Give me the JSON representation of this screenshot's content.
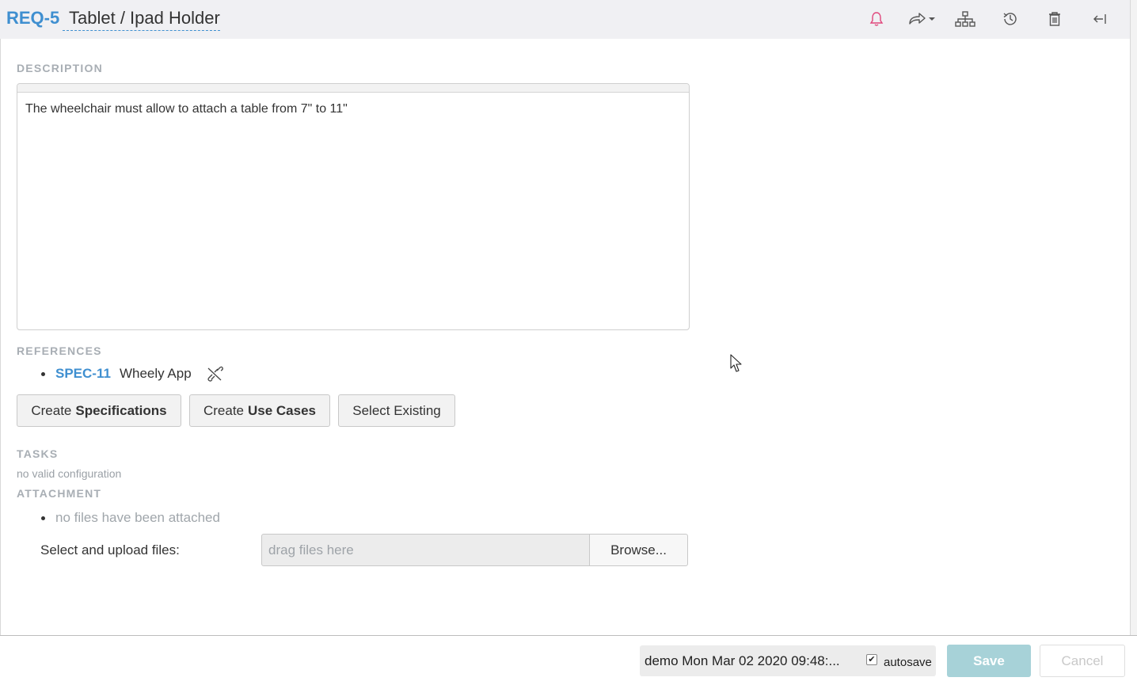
{
  "header": {
    "id": "REQ-5",
    "title": "Tablet / Ipad Holder",
    "icons": [
      "bell-icon",
      "share-icon",
      "hierarchy-icon",
      "history-icon",
      "trash-icon",
      "collapse-icon"
    ]
  },
  "description": {
    "label": "DESCRIPTION",
    "text": "The wheelchair must allow to attach a table from 7\" to 11\""
  },
  "references": {
    "label": "REFERENCES",
    "items": [
      {
        "id": "SPEC-11",
        "title": "Wheely App"
      }
    ],
    "buttons": {
      "create_spec_prefix": "Create",
      "create_spec_bold": "Specifications",
      "create_uc_prefix": "Create",
      "create_uc_bold": "Use Cases",
      "select_existing": "Select Existing"
    }
  },
  "tasks": {
    "label": "TASKS",
    "hint": "no valid configuration"
  },
  "attachment": {
    "label": "ATTACHMENT",
    "empty_text": "no files have been attached",
    "upload_label": "Select and upload files:",
    "drop_placeholder": "drag files here",
    "browse_label": "Browse..."
  },
  "footer": {
    "status": "demo Mon Mar 02 2020 09:48:...",
    "autosave_label": "autosave",
    "autosave_checked": true,
    "save_label": "Save",
    "cancel_label": "Cancel"
  },
  "colors": {
    "accent": "#3f8fd0",
    "bell": "#e0457b",
    "save_disabled": "#a7d2d8"
  }
}
